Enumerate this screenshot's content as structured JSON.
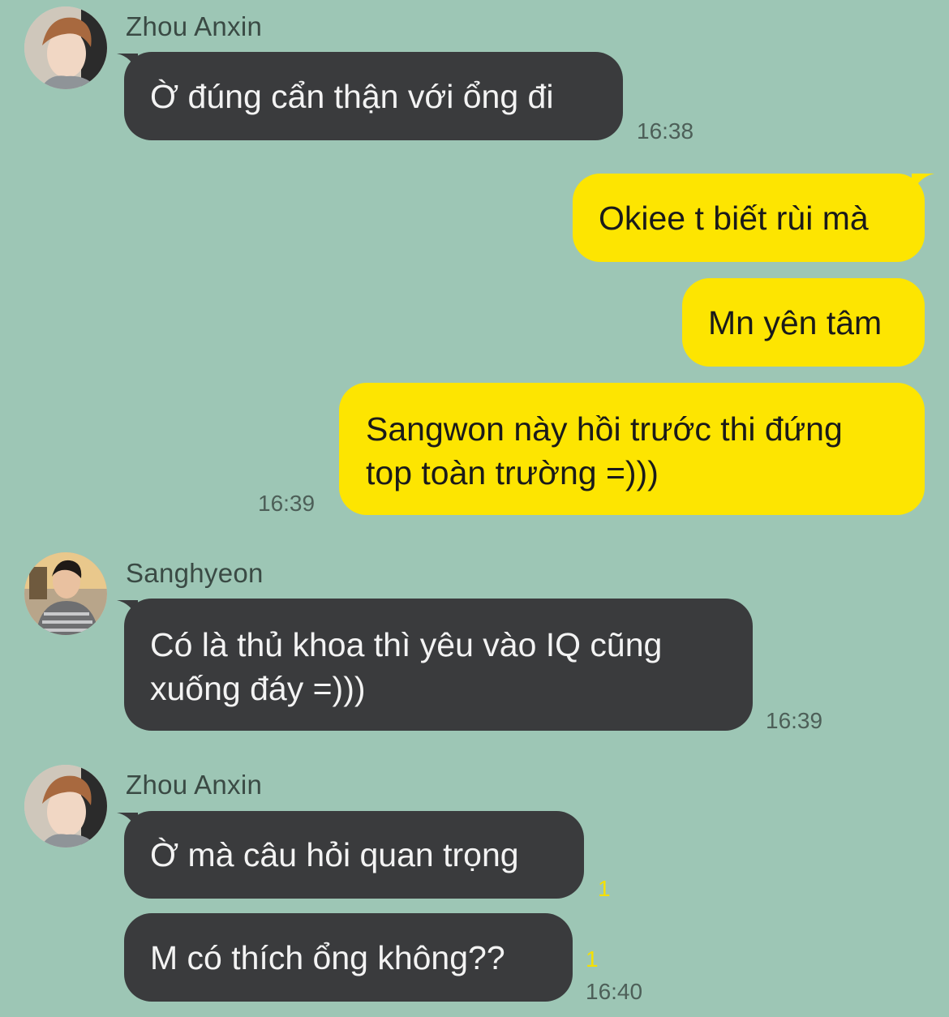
{
  "colors": {
    "background": "#9dc6b5",
    "incoming_bubble": "#3a3b3d",
    "outgoing_bubble": "#fde501",
    "unread_count": "#f5e000"
  },
  "messages": [
    {
      "sender": "Zhou Anxin",
      "avatar_icon": "profile-photo-icon",
      "text": "Ờ đúng cẩn thận với ổng đi",
      "time": "16:38"
    },
    {
      "sender": "me",
      "text": "Okiee t biết rùi mà"
    },
    {
      "sender": "me",
      "text": "Mn yên tâm"
    },
    {
      "sender": "me",
      "text_line1": "Sangwon này hồi trước thi đứng",
      "text_line2": "top toàn trường =)))",
      "time": "16:39"
    },
    {
      "sender": "Sanghyeon",
      "avatar_icon": "profile-photo-icon",
      "text_line1": "Có là thủ khoa thì yêu vào IQ cũng",
      "text_line2": "xuống đáy =)))",
      "time": "16:39"
    },
    {
      "sender": "Zhou Anxin",
      "avatar_icon": "profile-photo-icon",
      "text": "Ờ mà câu hỏi quan trọng",
      "unread": "1"
    },
    {
      "sender": "Zhou Anxin",
      "text": "M có thích ổng không??",
      "unread": "1",
      "time": "16:40"
    }
  ]
}
